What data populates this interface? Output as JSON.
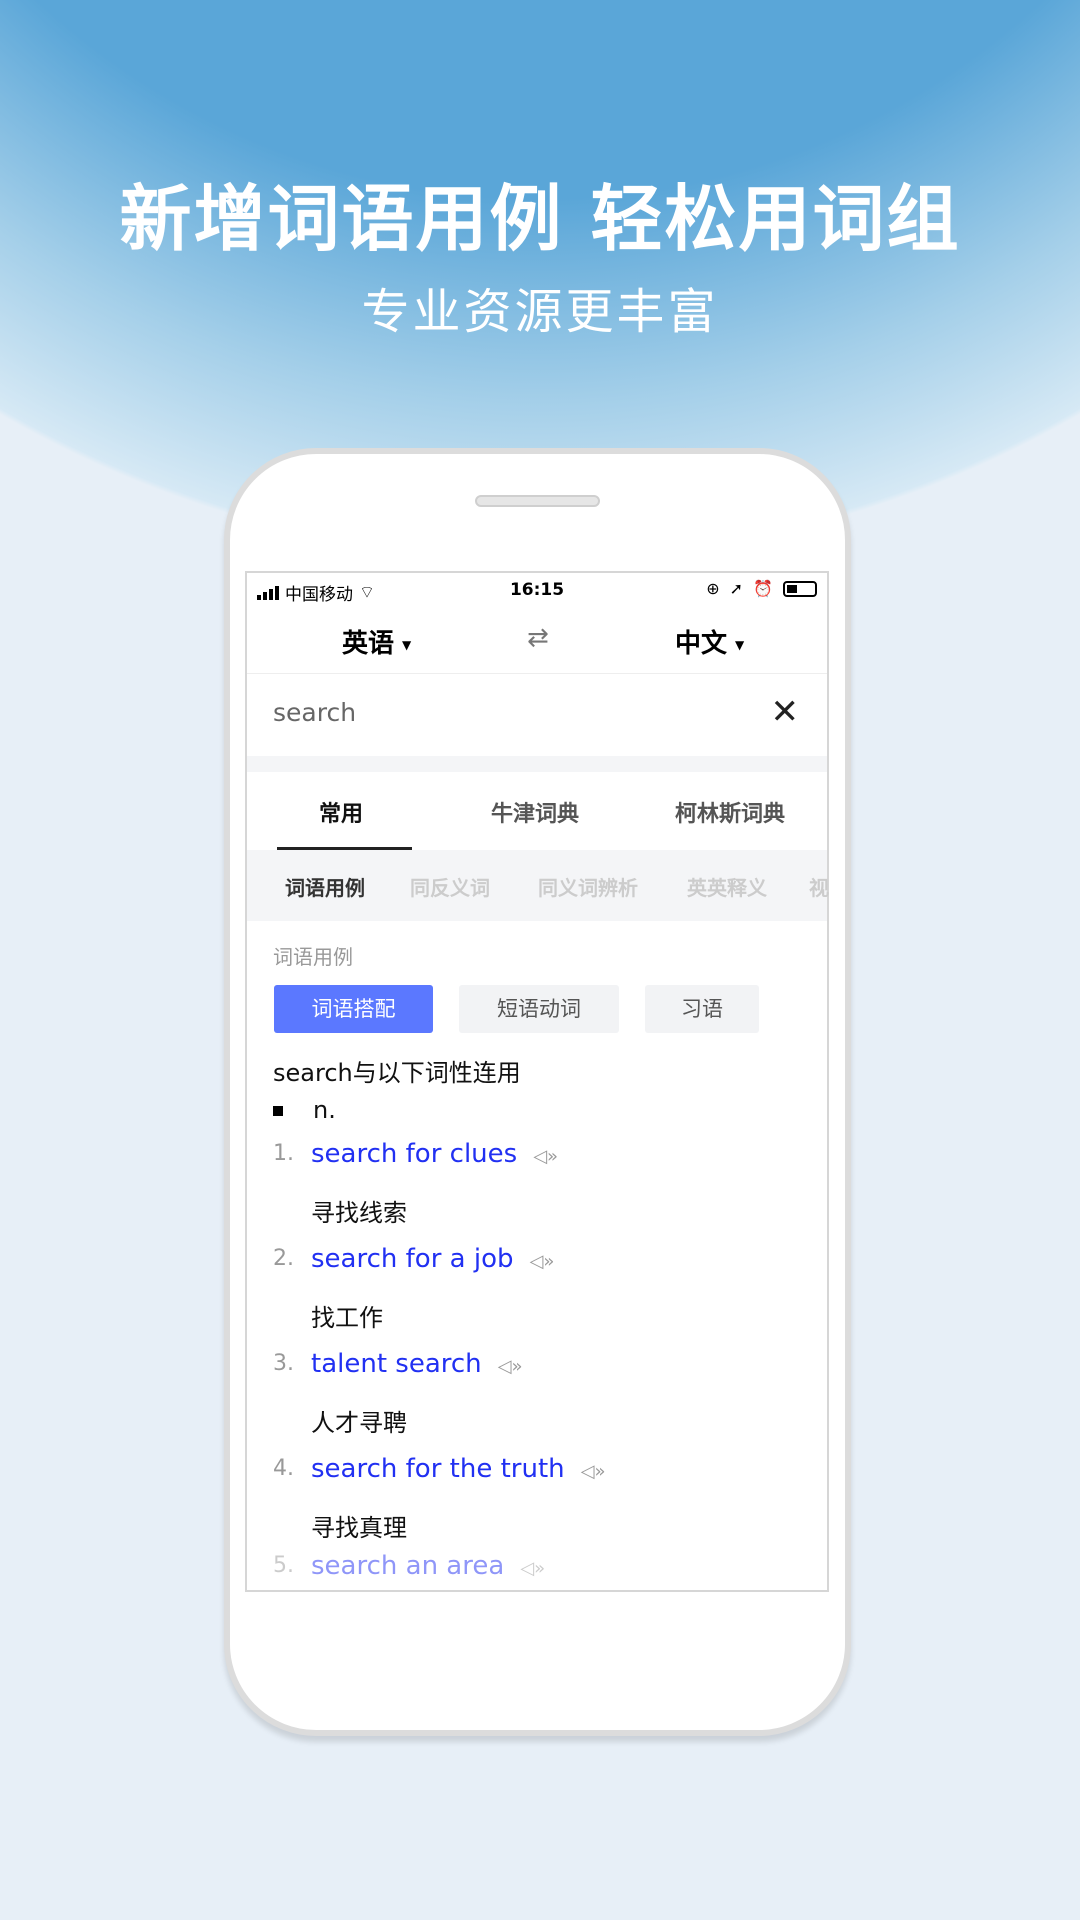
{
  "promo": {
    "headline": "新增词语用例 轻松用词组",
    "subtitle": "专业资源更丰富"
  },
  "status_bar": {
    "carrier": "中国移动",
    "time": "16:15"
  },
  "languages": {
    "source": "英语",
    "target": "中文",
    "swap_icon": "swap-arrows-icon"
  },
  "search": {
    "value": "search"
  },
  "tabs": [
    {
      "label": "常用",
      "active": true
    },
    {
      "label": "牛津词典"
    },
    {
      "label": "柯林斯词典"
    }
  ],
  "subtabs": [
    {
      "label": "词语用例",
      "active": true
    },
    {
      "label": "同反义词"
    },
    {
      "label": "同义词辨析"
    },
    {
      "label": "英英释义"
    },
    {
      "label": "视"
    }
  ],
  "section_title": "词语用例",
  "chips": [
    {
      "label": "词语搭配",
      "active": true
    },
    {
      "label": "短语动词"
    },
    {
      "label": "习语"
    }
  ],
  "intro": "search与以下词性连用",
  "pos": "n.",
  "items": [
    {
      "num": "1.",
      "en": "search for clues",
      "zh": "寻找线索"
    },
    {
      "num": "2.",
      "en": "search for a job",
      "zh": "找工作"
    },
    {
      "num": "3.",
      "en": "talent search",
      "zh": "人才寻聘"
    },
    {
      "num": "4.",
      "en": "search for the truth",
      "zh": "寻找真理"
    },
    {
      "num": "5.",
      "en": "search an area",
      "zh": ""
    }
  ],
  "colors": {
    "accent": "#5b78ff",
    "link": "#2130f2",
    "sky": "#5aa6d8"
  }
}
